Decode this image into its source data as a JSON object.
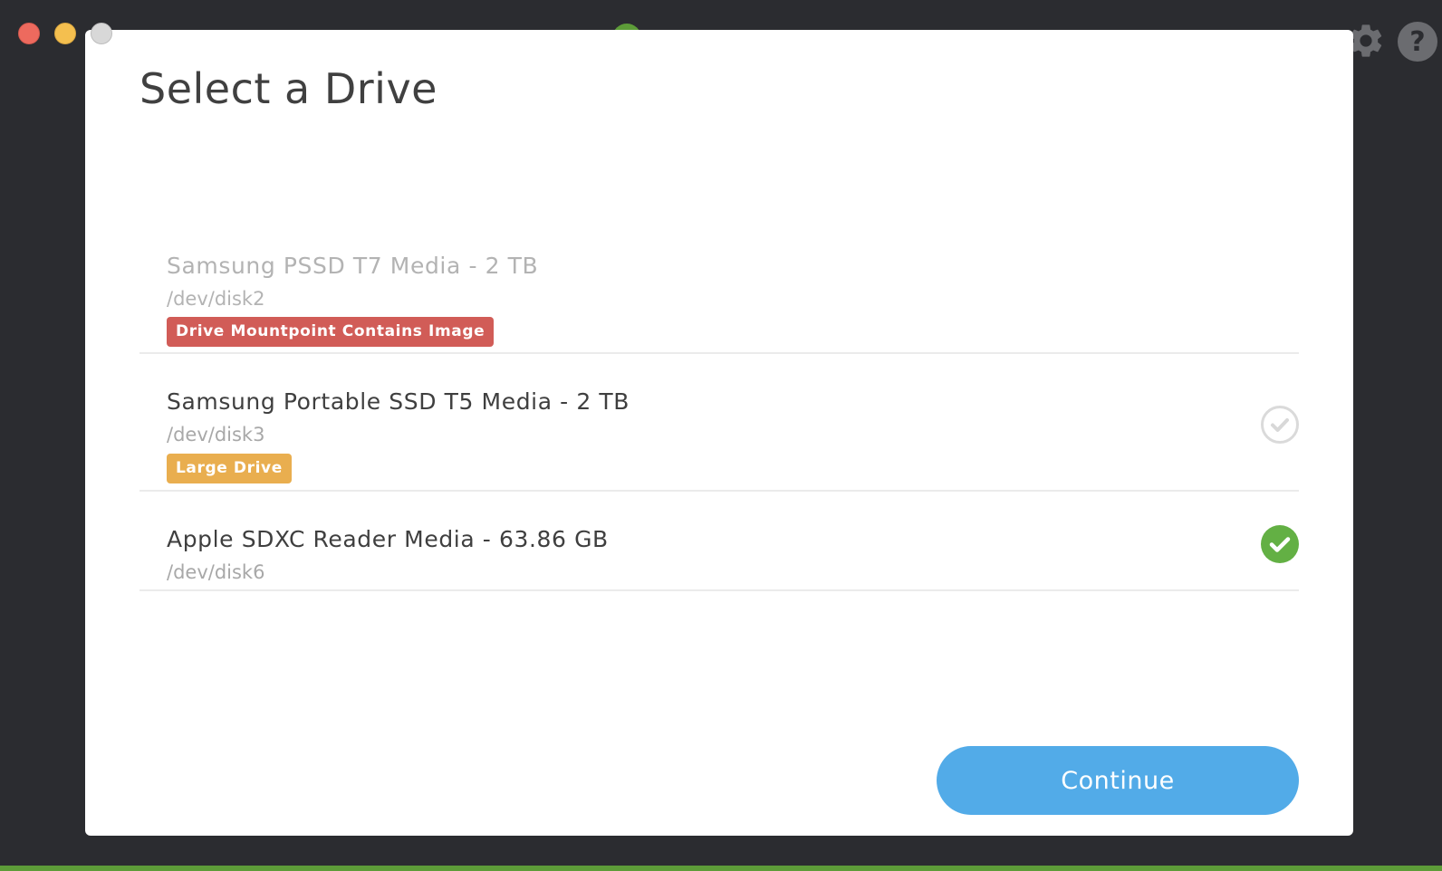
{
  "window": {
    "controls": [
      "close",
      "minimize",
      "zoom"
    ]
  },
  "toolbar": {
    "icons": [
      "gear-icon",
      "help-icon"
    ]
  },
  "modal": {
    "title": "Select a Drive",
    "drives": [
      {
        "name": "Samsung PSSD T7 Media - 2 TB",
        "path": "/dev/disk2",
        "badge": "Drive Mountpoint Contains Image",
        "badge_type": "danger",
        "disabled": true,
        "selected": false
      },
      {
        "name": "Samsung Portable SSD T5 Media - 2 TB",
        "path": "/dev/disk3",
        "badge": "Large Drive",
        "badge_type": "warning",
        "disabled": false,
        "selected": false
      },
      {
        "name": "Apple SDXC Reader Media - 63.86 GB",
        "path": "/dev/disk6",
        "badge": "",
        "disabled": false,
        "selected": true
      }
    ],
    "continue_label": "Continue"
  },
  "colors": {
    "background": "#2b2c30",
    "accent_blue": "#52abe8",
    "success_green": "#63b044",
    "danger_red": "#d15c57",
    "warning_orange": "#e9ae4f"
  }
}
